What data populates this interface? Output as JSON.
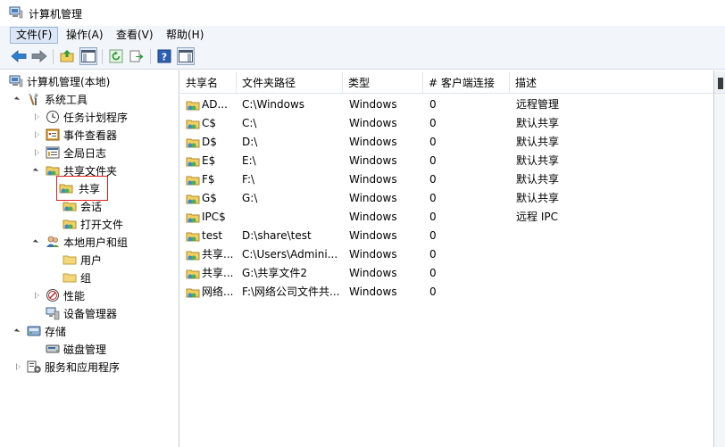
{
  "window": {
    "title": "计算机管理"
  },
  "menu": [
    {
      "label": "文件(F)",
      "active": true
    },
    {
      "label": "操作(A)"
    },
    {
      "label": "查看(V)"
    },
    {
      "label": "帮助(H)"
    }
  ],
  "toolbar": {
    "buttons": [
      "back-icon",
      "forward-icon",
      "up-folder-icon",
      "show-hide-tree-icon",
      "refresh-icon",
      "export-list-icon",
      "help-icon",
      "show-hide-action-pane-icon"
    ]
  },
  "tree": {
    "root": "计算机管理(本地)",
    "system_tools": "系统工具",
    "task_scheduler": "任务计划程序",
    "event_viewer": "事件查看器",
    "global_log": "全局日志",
    "shared_folders": "共享文件夹",
    "shares": "共享",
    "sessions": "会话",
    "open_files": "打开文件",
    "local_users_groups": "本地用户和组",
    "users": "用户",
    "groups": "组",
    "performance": "性能",
    "device_manager": "设备管理器",
    "storage": "存储",
    "disk_management": "磁盘管理",
    "services_apps": "服务和应用程序"
  },
  "list": {
    "columns": [
      "共享名",
      "文件夹路径",
      "类型",
      "# 客户端连接",
      "描述"
    ],
    "rows": [
      {
        "name": "AD...",
        "path": "C:\\Windows",
        "type": "Windows",
        "clients": "0",
        "desc": "远程管理"
      },
      {
        "name": "C$",
        "path": "C:\\",
        "type": "Windows",
        "clients": "0",
        "desc": "默认共享"
      },
      {
        "name": "D$",
        "path": "D:\\",
        "type": "Windows",
        "clients": "0",
        "desc": "默认共享"
      },
      {
        "name": "E$",
        "path": "E:\\",
        "type": "Windows",
        "clients": "0",
        "desc": "默认共享"
      },
      {
        "name": "F$",
        "path": "F:\\",
        "type": "Windows",
        "clients": "0",
        "desc": "默认共享"
      },
      {
        "name": "G$",
        "path": "G:\\",
        "type": "Windows",
        "clients": "0",
        "desc": "默认共享"
      },
      {
        "name": "IPC$",
        "path": "",
        "type": "Windows",
        "clients": "0",
        "desc": "远程 IPC"
      },
      {
        "name": "test",
        "path": "D:\\share\\test",
        "type": "Windows",
        "clients": "0",
        "desc": ""
      },
      {
        "name": "共享...",
        "path": "C:\\Users\\Admini...",
        "type": "Windows",
        "clients": "0",
        "desc": ""
      },
      {
        "name": "共享...",
        "path": "G:\\共享文件2",
        "type": "Windows",
        "clients": "0",
        "desc": ""
      },
      {
        "name": "网络...",
        "path": "F:\\网络公司文件共...",
        "type": "Windows",
        "clients": "0",
        "desc": ""
      }
    ]
  },
  "colors": {
    "menubar": "#f2f5fa",
    "selection_outline": "#e02020",
    "tree_border": "#c5ccd6"
  }
}
